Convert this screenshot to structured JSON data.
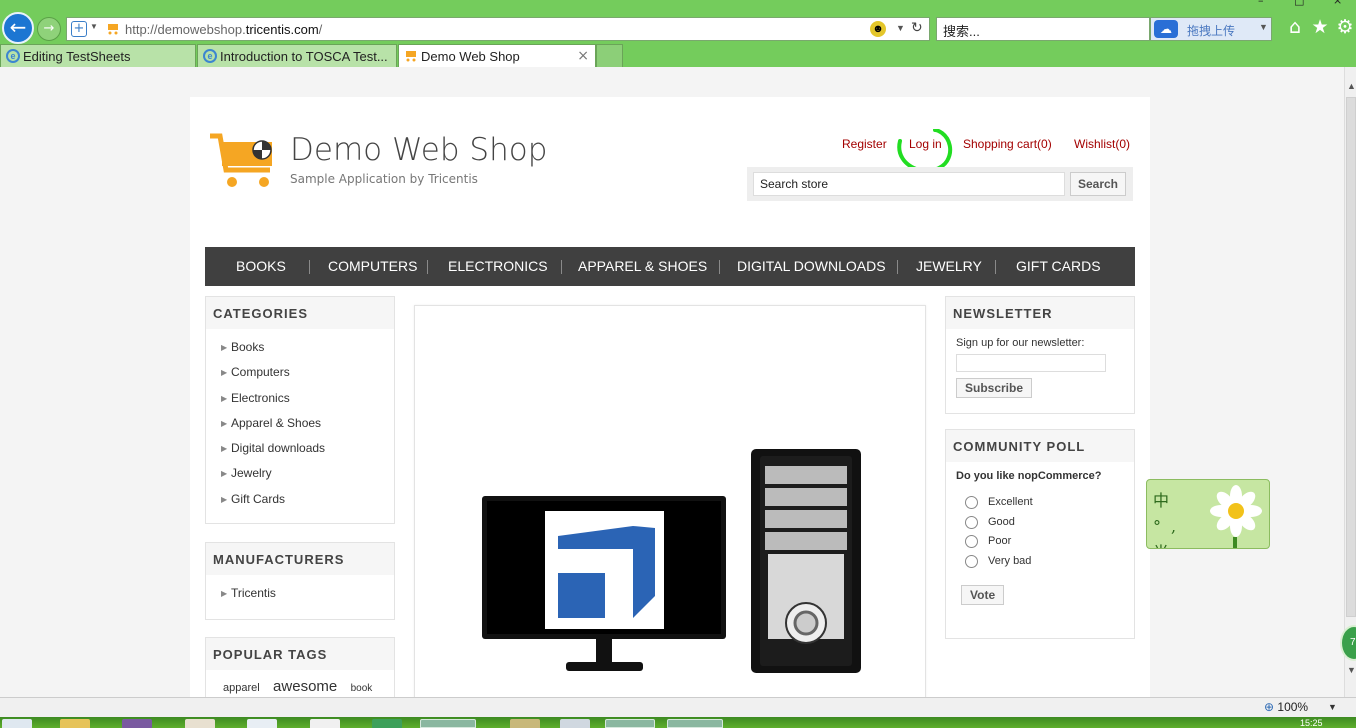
{
  "browser": {
    "url_prefix": "http://demowebshop.",
    "url_domain": "tricentis.com",
    "url_suffix": "/",
    "search_placeholder": "搜索...",
    "cloud_label": "拖拽上传",
    "tabs": [
      {
        "label": "Editing TestSheets",
        "active": false
      },
      {
        "label": "Introduction to TOSCA Test...",
        "active": false
      },
      {
        "label": "Demo Web Shop",
        "active": true
      }
    ],
    "zoom": "100%",
    "clock": "15:25"
  },
  "header": {
    "title": "Demo Web Shop",
    "subtitle": "Sample Application by Tricentis",
    "links": {
      "register": "Register",
      "login": "Log in",
      "cart": "Shopping cart(0)",
      "wishlist": "Wishlist(0)"
    },
    "search": {
      "value": "Search store",
      "button": "Search"
    }
  },
  "menu": [
    "BOOKS",
    "COMPUTERS",
    "ELECTRONICS",
    "APPAREL & SHOES",
    "DIGITAL DOWNLOADS",
    "JEWELRY",
    "GIFT CARDS"
  ],
  "categories": {
    "title": "CATEGORIES",
    "items": [
      "Books",
      "Computers",
      "Electronics",
      "Apparel & Shoes",
      "Digital downloads",
      "Jewelry",
      "Gift Cards"
    ]
  },
  "manufacturers": {
    "title": "MANUFACTURERS",
    "items": [
      "Tricentis"
    ]
  },
  "popular_tags": {
    "title": "POPULAR TAGS",
    "tags": [
      "apparel",
      "awesome",
      "book"
    ]
  },
  "newsletter": {
    "title": "NEWSLETTER",
    "label": "Sign up for our newsletter:",
    "button": "Subscribe"
  },
  "poll": {
    "title": "COMMUNITY POLL",
    "question": "Do you like nopCommerce?",
    "options": [
      "Excellent",
      "Good",
      "Poor",
      "Very bad"
    ],
    "button": "Vote"
  },
  "ime": {
    "chars": "中 °, 半 简"
  },
  "colors": {
    "link_red": "#a30000",
    "menu_bg": "#404040",
    "chrome_green": "#74cc5c",
    "annotation_green": "#22dd22"
  },
  "icons": [
    "back-arrow-icon",
    "forward-arrow-icon",
    "home-icon",
    "star-icon",
    "gear-icon",
    "refresh-icon",
    "ie-icon",
    "cart-icon"
  ]
}
